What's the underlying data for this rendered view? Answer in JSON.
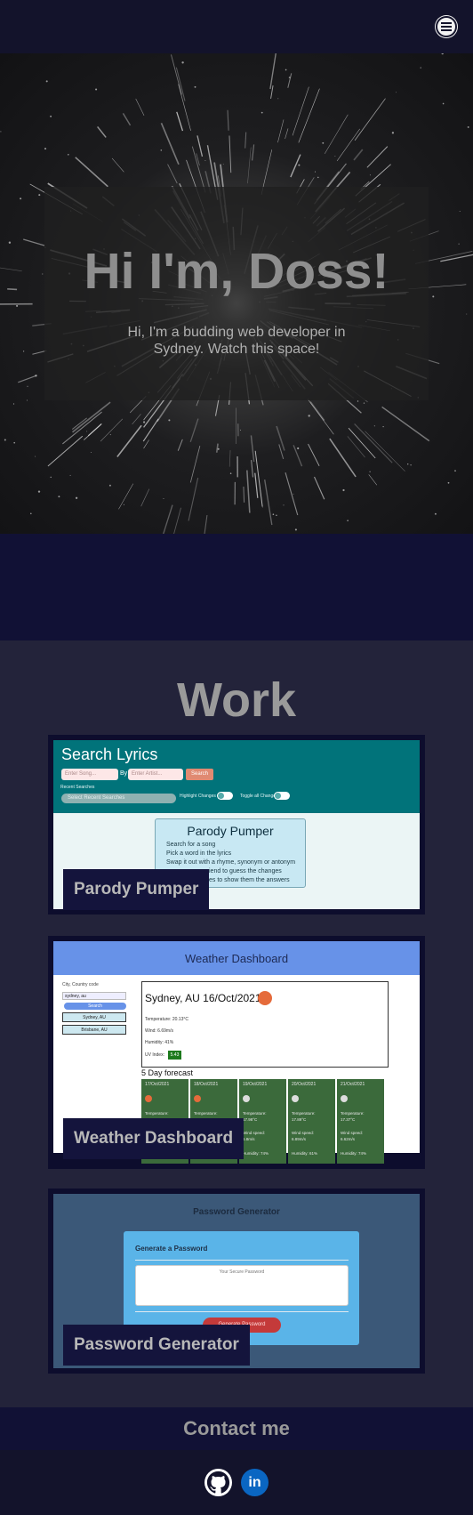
{
  "nav": {
    "menu_icon": "hamburger-menu-icon"
  },
  "hero": {
    "title": "Hi I'm, Doss!",
    "subtitle": "Hi, I'm a budding web developer in Sydney. Watch this space!"
  },
  "work": {
    "title": "Work",
    "projects": [
      {
        "label": "Parody Pumper",
        "preview": {
          "header_title": "Search Lyrics",
          "song_placeholder": "Enter Song...",
          "by_label": "By",
          "artist_placeholder": "Enter Artist...",
          "search_button": "Search",
          "recent_label": "Recent Searches",
          "recent_select": "Select Recent Searches",
          "highlight_label": "Highlight Changes",
          "toggle_label": "Toggle all Changes",
          "card_title": "Parody Pumper",
          "card_lines": [
            "Search for a song",
            "Pick a word in the lyrics",
            "Swap it out with a rhyme, synonym or antonym",
            "iend to guess the changes",
            "es to show them the answers"
          ]
        }
      },
      {
        "label": "Weather Dashboard",
        "preview": {
          "header_title": "Weather Dashboard",
          "city_label": "City, Country code",
          "city_value": "sydney, au",
          "search_button": "Search",
          "history": [
            "Sydney, AU",
            "Brisbane, AU"
          ],
          "current_title": "Sydney, AU 16/Oct/2021",
          "temperature": "Temperature: 20.13°C",
          "wind": "Wind: 6.69m/s",
          "humidity": "Humidity: 41%",
          "uv_label": "UV Index:",
          "uv_value": "5.43",
          "forecast_title": "5 Day forecast",
          "forecast": [
            {
              "date": "17/Oct/2021",
              "l1": "Temperature:",
              "l2": "",
              "l3": "",
              "l4": ""
            },
            {
              "date": "18/Oct/2021",
              "l1": "Temperature:",
              "l2": "",
              "l3": "",
              "l4": ""
            },
            {
              "date": "19/Oct/2021",
              "l1": "Temperature:",
              "l2": "17.98°C",
              "l3": "Wind speed:",
              "l4": "6.8m/s"
            },
            {
              "date": "20/Oct/2021",
              "l1": "Temperature:",
              "l2": "17.89°C",
              "l3": "Wind speed:",
              "l4": "6.89m/s"
            },
            {
              "date": "21/Oct/2021",
              "l1": "Temperature:",
              "l2": "17.37°C",
              "l3": "Wind speed:",
              "l4": "6.62m/s"
            }
          ],
          "forecast_humidity": [
            "Humidity: 74%",
            "Humidity: 61%",
            "Humidity: 74%"
          ]
        }
      },
      {
        "label": "Password Generator",
        "preview": {
          "header_title": "Password Generator",
          "card_title": "Generate a Password",
          "placeholder": "Your Secure Password",
          "button": "Generate Password"
        }
      }
    ]
  },
  "contact": {
    "title": "Contact me"
  },
  "footer": {
    "github_icon": "github-icon",
    "linkedin_icon": "linkedin-icon",
    "linkedin_text": "in"
  },
  "colors": {
    "nav_bg": "#13132b",
    "accent_navy": "#111135",
    "body_bg": "#23233a",
    "text_gray": "#9a9a9a"
  }
}
